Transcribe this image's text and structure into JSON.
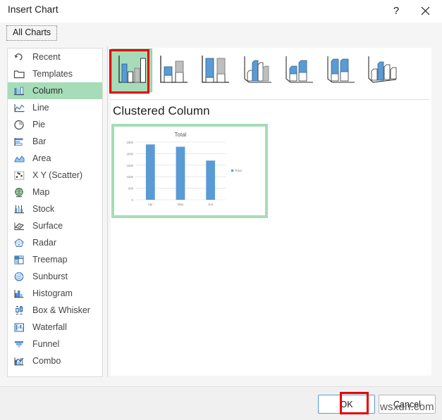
{
  "window": {
    "title": "Insert Chart",
    "help_label": "?",
    "close_label": "✕"
  },
  "tabs": [
    {
      "label": "All Charts",
      "selected": true
    }
  ],
  "sidebar": {
    "items": [
      {
        "label": "Recent",
        "icon": "recent-icon",
        "selected": false
      },
      {
        "label": "Templates",
        "icon": "templates-icon",
        "selected": false
      },
      {
        "label": "Column",
        "icon": "column-icon",
        "selected": true
      },
      {
        "label": "Line",
        "icon": "line-icon",
        "selected": false
      },
      {
        "label": "Pie",
        "icon": "pie-icon",
        "selected": false
      },
      {
        "label": "Bar",
        "icon": "bar-icon",
        "selected": false
      },
      {
        "label": "Area",
        "icon": "area-icon",
        "selected": false
      },
      {
        "label": "X Y (Scatter)",
        "icon": "scatter-icon",
        "selected": false
      },
      {
        "label": "Map",
        "icon": "map-icon",
        "selected": false
      },
      {
        "label": "Stock",
        "icon": "stock-icon",
        "selected": false
      },
      {
        "label": "Surface",
        "icon": "surface-icon",
        "selected": false
      },
      {
        "label": "Radar",
        "icon": "radar-icon",
        "selected": false
      },
      {
        "label": "Treemap",
        "icon": "treemap-icon",
        "selected": false
      },
      {
        "label": "Sunburst",
        "icon": "sunburst-icon",
        "selected": false
      },
      {
        "label": "Histogram",
        "icon": "histogram-icon",
        "selected": false
      },
      {
        "label": "Box & Whisker",
        "icon": "box-whisker-icon",
        "selected": false
      },
      {
        "label": "Waterfall",
        "icon": "waterfall-icon",
        "selected": false
      },
      {
        "label": "Funnel",
        "icon": "funnel-icon",
        "selected": false
      },
      {
        "label": "Combo",
        "icon": "combo-icon",
        "selected": false
      }
    ]
  },
  "gallery": {
    "thumbnails": [
      {
        "name": "clustered-column",
        "selected": true
      },
      {
        "name": "stacked-column",
        "selected": false
      },
      {
        "name": "100-stacked-column",
        "selected": false
      },
      {
        "name": "3d-clustered-column",
        "selected": false
      },
      {
        "name": "3d-stacked-column",
        "selected": false
      },
      {
        "name": "3d-100-stacked-column",
        "selected": false
      },
      {
        "name": "3d-column",
        "selected": false
      }
    ]
  },
  "preview": {
    "heading": "Clustered Column"
  },
  "chart_data": {
    "type": "bar",
    "title": "Total",
    "categories": [
      "Apr",
      "May",
      "Jun"
    ],
    "series": [
      {
        "name": "Total",
        "values": [
          2400,
          2300,
          1700
        ]
      }
    ],
    "ytick_labels": [
      "0",
      "500",
      "1000",
      "1500",
      "2000",
      "2500"
    ],
    "ytick_values": [
      0,
      500,
      1000,
      1500,
      2000,
      2500
    ],
    "ylim": [
      0,
      2500
    ],
    "xlabel": "",
    "ylabel": "",
    "grid": true,
    "legend": {
      "position": "right",
      "entries": [
        "Total"
      ]
    },
    "bar_color": "#5b9bd5"
  },
  "footer": {
    "ok_label": "OK",
    "cancel_label": "Cancel"
  },
  "watermark": {
    "text": "wsxdn.com"
  },
  "colors": {
    "selection_green": "#a6dcb8",
    "annotation_red": "#e60000",
    "chart_blue": "#5b9bd5",
    "focus_blue": "#5a9bd5"
  }
}
